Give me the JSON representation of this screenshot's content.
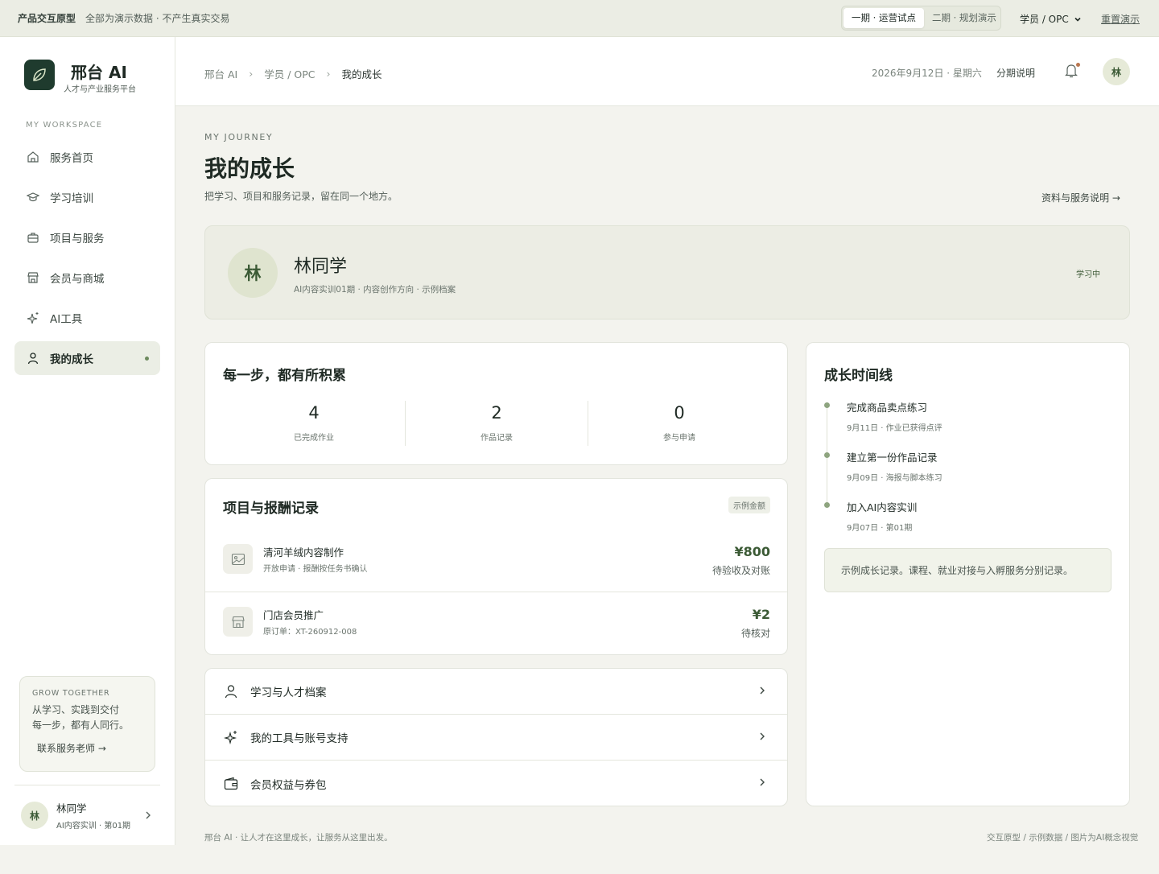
{
  "topbar": {
    "tag": "产品交互原型",
    "note": "全部为演示数据 · 不产生真实交易",
    "phases": [
      "一期 · 运营试点",
      "二期 · 规划演示"
    ],
    "role": "学员 / OPC",
    "reset": "重置演示"
  },
  "sidebar": {
    "brand": "邢台 AI",
    "brand_sub": "人才与产业服务平台",
    "workspace_label": "MY WORKSPACE",
    "items": [
      {
        "label": "服务首页",
        "icon": "home-icon"
      },
      {
        "label": "学习培训",
        "icon": "graduation-cap-icon"
      },
      {
        "label": "项目与服务",
        "icon": "briefcase-icon"
      },
      {
        "label": "会员与商城",
        "icon": "store-icon"
      },
      {
        "label": "AI工具",
        "icon": "sparkles-icon"
      },
      {
        "label": "我的成长",
        "icon": "user-icon",
        "active": true
      }
    ],
    "grow": {
      "title": "GROW TOGETHER",
      "desc_line1": "从学习、实践到交付",
      "desc_line2": "每一步，都有人同行。",
      "link": "联系服务老师"
    },
    "user": {
      "avatar": "林",
      "name": "林同学",
      "sub": "AI内容实训 · 第01期"
    }
  },
  "header": {
    "crumbs": [
      "邢台 AI",
      "学员 / OPC",
      "我的成长"
    ],
    "date": "2026年9月12日 · 星期六",
    "plan": "分期说明",
    "avatar": "林"
  },
  "page": {
    "kicker": "MY JOURNEY",
    "title": "我的成长",
    "subtitle": "把学习、项目和服务记录，留在同一个地方。",
    "info_link": "资料与服务说明"
  },
  "profile": {
    "avatar": "林",
    "name": "林同学",
    "desc": "AI内容实训01期 · 内容创作方向 · 示例档案",
    "status": "学习中"
  },
  "stats": {
    "title": "每一步，都有所积累",
    "items": [
      {
        "value": "4",
        "label": "已完成作业"
      },
      {
        "value": "2",
        "label": "作品记录"
      },
      {
        "value": "0",
        "label": "参与申请"
      }
    ]
  },
  "records": {
    "title": "项目与报酬记录",
    "badge": "示例金额",
    "items": [
      {
        "name": "清河羊绒内容制作",
        "sub": "开放申请 · 报酬按任务书确认",
        "amount": "¥800",
        "status": "待验收及对账",
        "icon": "image-icon"
      },
      {
        "name": "门店会员推广",
        "sub": "原订单：XT-260912-008",
        "amount": "¥2",
        "status": "待核对",
        "icon": "store-icon"
      }
    ]
  },
  "links": [
    {
      "label": "学习与人才档案",
      "icon": "user-icon"
    },
    {
      "label": "我的工具与账号支持",
      "icon": "sparkles-icon"
    },
    {
      "label": "会员权益与券包",
      "icon": "wallet-icon"
    }
  ],
  "timeline": {
    "title": "成长时间线",
    "items": [
      {
        "title": "完成商品卖点练习",
        "sub": "9月11日 · 作业已获得点评"
      },
      {
        "title": "建立第一份作品记录",
        "sub": "9月09日 · 海报与脚本练习"
      },
      {
        "title": "加入AI内容实训",
        "sub": "9月07日 · 第01期"
      }
    ],
    "note": "示例成长记录。课程、就业对接与入孵服务分别记录。"
  },
  "footer": {
    "left": "邢台 AI · 让人才在这里成长，让服务从这里出发。",
    "right": "交互原型 / 示例数据 / 图片为AI概念视觉"
  }
}
